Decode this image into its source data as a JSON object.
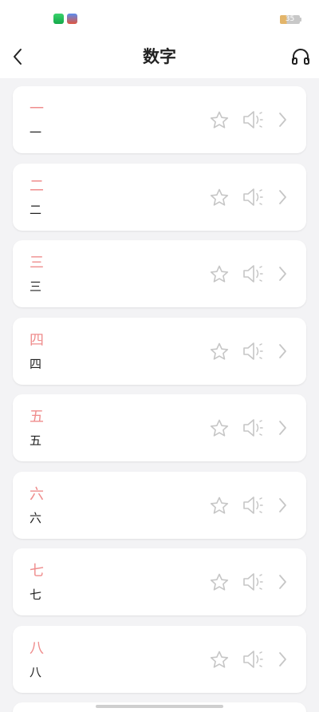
{
  "status_bar": {
    "battery": "35"
  },
  "header": {
    "title": "数字",
    "back_icon": "chevron-left-icon",
    "audio_icon": "headphones-icon"
  },
  "items": [
    {
      "char": "一",
      "label": "一"
    },
    {
      "char": "二",
      "label": "二"
    },
    {
      "char": "三",
      "label": "三"
    },
    {
      "char": "四",
      "label": "四"
    },
    {
      "char": "五",
      "label": "五"
    },
    {
      "char": "六",
      "label": "六"
    },
    {
      "char": "七",
      "label": "七"
    },
    {
      "char": "八",
      "label": "八"
    }
  ],
  "item_icons": {
    "favorite": "star-outline-icon",
    "audio": "speaker-icon",
    "open": "chevron-right-icon"
  },
  "colors": {
    "accent": "#ef8d8d",
    "icon_gray": "#c6c6c6",
    "background": "#f3f3f5"
  }
}
